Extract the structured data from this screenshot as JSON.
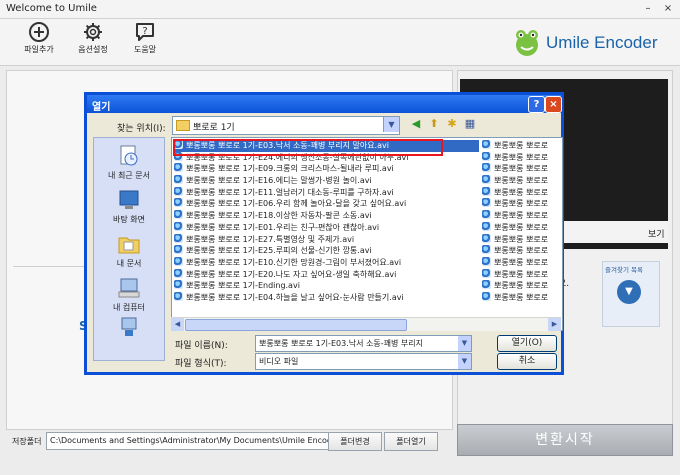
{
  "window": {
    "title": "Welcome to Umile"
  },
  "toolbar": {
    "add_file": "파일추가",
    "options": "옵션설정",
    "help": "도움말"
  },
  "logo": {
    "text": "Umile Encoder"
  },
  "right_panel": {
    "preview_label": "보기",
    "favorites_label": "즐겨찾기 목록",
    "mini_text": "요."
  },
  "left_panel": {
    "fragment": "S"
  },
  "convert_button": "변환시작",
  "save": {
    "label": "저장폴더",
    "path": "C:\\Documents and Settings\\Administrator\\My Documents\\Umile Encoder",
    "change_folder": "폴더변경",
    "open_folder": "폴더열기"
  },
  "dialog": {
    "title": "열기",
    "look_in_label": "찾는 위치(I):",
    "look_in_value": "뽀로로 1기",
    "places": [
      "내 최근 문서",
      "바탕 화면",
      "내 문서",
      "내 컴퓨터",
      ""
    ],
    "files_col1": [
      "뽀롱뽀롱 뽀로로 1기-E03.낙서 소동-꽤병 부리지 말아요.avi",
      "뽀롱뽀롱 뽀로로 1기-E24.에디의 생신소동-실족에관없이 아누.avi",
      "뽀롱뽀롱 뽀로로 1기-E09.크롱의 크리스마스-될내라 루피.avi",
      "뽀롱뽀롱 뽀로로 1기-E16.에디는 말썽가-병원 놀이.avi",
      "뽀롱뽀롱 뽀로로 1기-E11.얼남러기 대소동-루피를 구하자.avi",
      "뽀롱뽀롱 뽀로로 1기-E06.우리 함께 놀아요-달을 갖고 싶어요.avi",
      "뽀롱뽀롱 뽀로로 1기-E18.이상한 자동차-팔콘 소동.avi",
      "뽀롱뽀롱 뽀로로 1기-E01.우리는 친구-편찮아 괜찮아.avi",
      "뽀롱뽀롱 뽀로로 1기-E27.특별영상 및 주제가.avi",
      "뽀롱뽀롱 뽀로로 1기-E25.루피의 선물-신기한 깡통.avi",
      "뽀롱뽀롱 뽀로로 1기-E10.신기한 망원경-그림이 부서졌어요.avi",
      "뽀롱뽀롱 뽀로로 1기-E20.나도 자고 싶어요-생일 축하해요.avi",
      "뽀롱뽀롱 뽀로로 1기-Ending.avi",
      "뽀롱뽀롱 뽀로로 1기-E04.하늘을 날고 싶어요-눈사람 만들기.avi"
    ],
    "files_col2": [
      "뽀롱뽀롱 뽀로로",
      "뽀롱뽀롱 뽀로로",
      "뽀롱뽀롱 뽀로로",
      "뽀롱뽀롱 뽀로로",
      "뽀롱뽀롱 뽀로로",
      "뽀롱뽀롱 뽀로로",
      "뽀롱뽀롱 뽀로로",
      "뽀롱뽀롱 뽀로로",
      "뽀롱뽀롱 뽀로로",
      "뽀롱뽀롱 뽀로로",
      "뽀롱뽀롱 뽀로로",
      "뽀롱뽀롱 뽀로로",
      "뽀롱뽀롱 뽀로로",
      "뽀롱뽀롱 뽀로로"
    ],
    "file_name_label": "파일 이름(N):",
    "file_name_value": "뽀롱뽀롱 뽀로로 1기-E03.낙서 소동-꽤병 부리지",
    "file_type_label": "파일 형식(T):",
    "file_type_value": "비디오 파일",
    "open_button": "열기(O)",
    "cancel_button": "취소"
  },
  "colors": {
    "accent": "#1a63a8",
    "dialog_border": "#0a4fd6",
    "selection": "#316ac5",
    "highlight_box": "#e8171f"
  }
}
